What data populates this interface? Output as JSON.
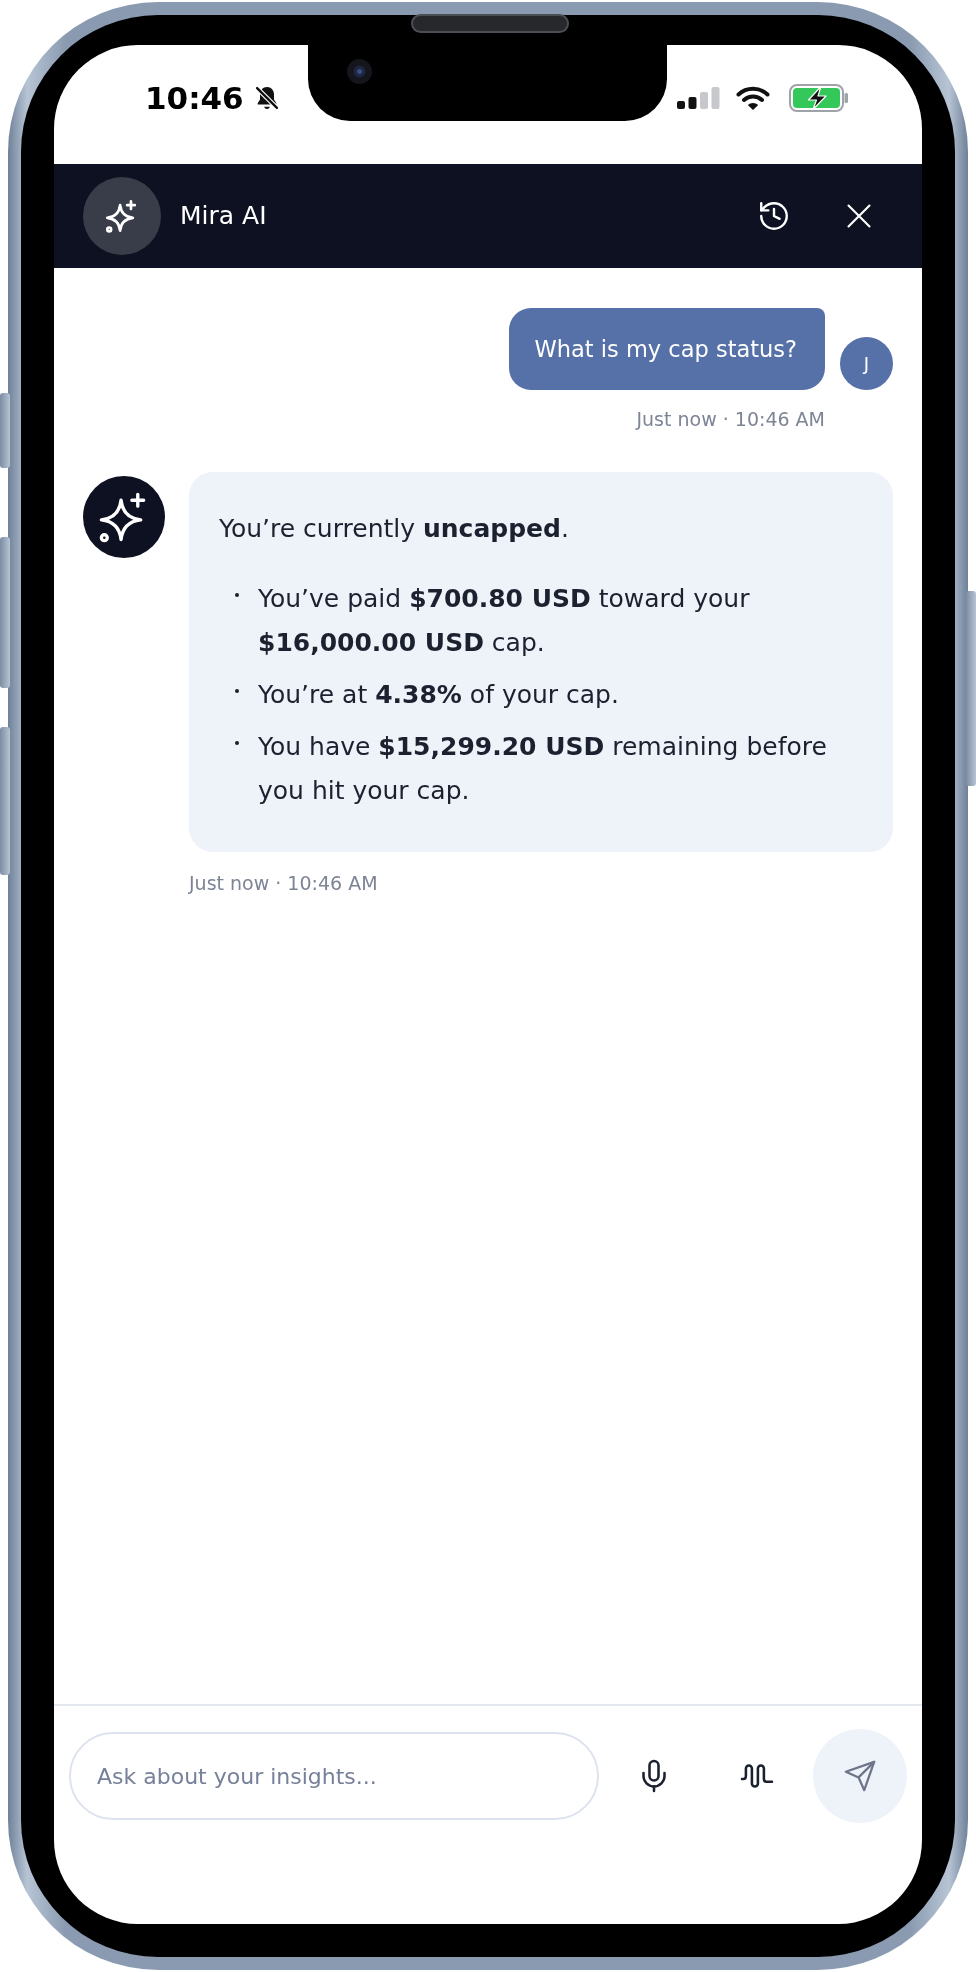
{
  "status_bar": {
    "time": "10:46"
  },
  "header": {
    "title": "Mira AI"
  },
  "messages": [
    {
      "kind": "user",
      "text": "What is my cap status?",
      "avatar": "J",
      "timestamp": "Just now · 10:46 AM"
    },
    {
      "kind": "assistant",
      "intro": "You’re currently **uncapped**.",
      "bullets": [
        "You’ve paid **$700.80 USD** toward your **$16,000.00 USD** cap.",
        "You’re at **4.38%** of your cap.",
        "You have **$15,299.20 USD** remaining before you hit your cap."
      ],
      "timestamp": "Just now · 10:46 AM"
    }
  ],
  "composer": {
    "placeholder": "Ask about your insights..."
  }
}
